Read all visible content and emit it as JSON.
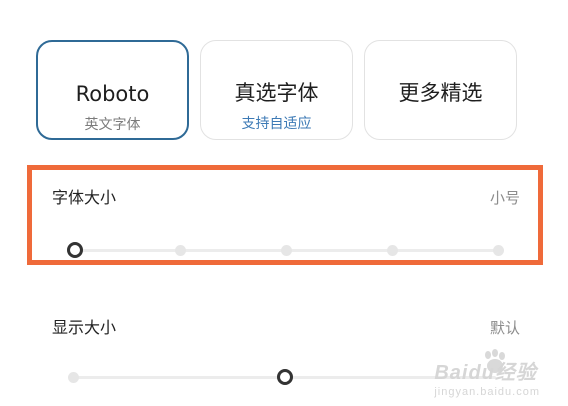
{
  "font_cards": [
    {
      "name": "Roboto",
      "sub": "英文字体",
      "sub_color": "#7b7b7b",
      "selected": true
    },
    {
      "name": "真选字体",
      "sub": "支持自适应",
      "sub_color": "#3d7ab5",
      "selected": false
    },
    {
      "name": "更多精选",
      "sub": "",
      "sub_color": "#7b7b7b",
      "selected": false
    }
  ],
  "font_size": {
    "label": "字体大小",
    "value": "小号",
    "steps": 5,
    "selected_step_index": 0
  },
  "display_size": {
    "label": "显示大小",
    "value": "默认",
    "selected_step_index": 2
  },
  "watermark": {
    "brand": "Baidu经验",
    "url": "jingyan.baidu.com"
  },
  "colors": {
    "accent_border": "#2f6a96",
    "link_blue": "#3d7ab5",
    "highlight_orange": "#ef6a3a"
  }
}
